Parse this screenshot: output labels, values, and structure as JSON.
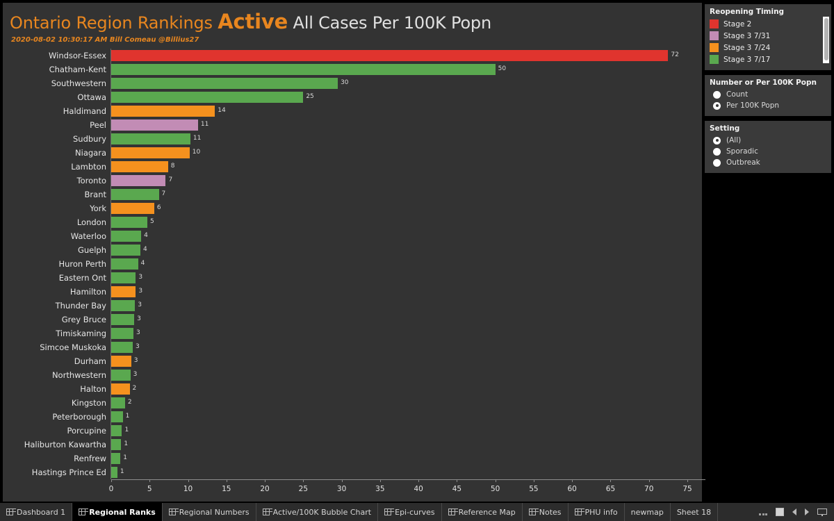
{
  "header": {
    "title_main": "Ontario Region Rankings ",
    "title_emphasis": "Active",
    "title_rest": " All Cases Per 100K Popn",
    "subtitle": "2020-08-02 10:30:17 AM Bill Comeau @Billius27"
  },
  "colors": {
    "stage2_red": "#e0342e",
    "stage3_0731_purple": "#c28cb5",
    "stage3_0724_orange": "#f5911e",
    "stage3_0717_green": "#5aa84f",
    "background": "#333333",
    "panel": "#3a3a3a",
    "accent_orange": "#e8861f"
  },
  "legend": {
    "title": "Reopening Timing",
    "items": [
      {
        "label": "Stage 2",
        "color": "#e0342e"
      },
      {
        "label": "Stage 3 7/31",
        "color": "#c28cb5"
      },
      {
        "label": "Stage 3 7/24",
        "color": "#f5911e"
      },
      {
        "label": "Stage 3 7/17",
        "color": "#5aa84f"
      }
    ]
  },
  "number_filter": {
    "title": "Number or Per 100K Popn",
    "options": [
      {
        "label": "Count",
        "selected": false
      },
      {
        "label": "Per 100K Popn",
        "selected": true
      }
    ]
  },
  "setting_filter": {
    "title": "Setting",
    "options": [
      {
        "label": "(All)",
        "selected": true
      },
      {
        "label": "Sporadic",
        "selected": false
      },
      {
        "label": "Outbreak",
        "selected": false
      }
    ]
  },
  "chart_data": {
    "type": "bar",
    "orientation": "horizontal",
    "title": "Ontario Region Rankings Active All Cases Per 100K Popn",
    "xlabel": "",
    "ylabel": "",
    "xlim": [
      0,
      77.3
    ],
    "xticks": [
      0,
      5,
      10,
      15,
      20,
      25,
      30,
      35,
      40,
      45,
      50,
      55,
      60,
      65,
      70,
      75
    ],
    "grid": false,
    "legend_position": "right",
    "color_key": {
      "Stage 2": "#e0342e",
      "Stage 3 7/31": "#c28cb5",
      "Stage 3 7/24": "#f5911e",
      "Stage 3 7/17": "#5aa84f"
    },
    "categories": [
      "Windsor-Essex",
      "Chatham-Kent",
      "Southwestern",
      "Ottawa",
      "Haldimand",
      "Peel",
      "Sudbury",
      "Niagara",
      "Lambton",
      "Toronto",
      "Brant",
      "York",
      "London",
      "Waterloo",
      "Guelph",
      "Huron Perth",
      "Eastern Ont",
      "Hamilton",
      "Thunder Bay",
      "Grey Bruce",
      "Timiskaming",
      "Simcoe Muskoka",
      "Durham",
      "Northwestern",
      "Halton",
      "Kingston",
      "Peterborough",
      "Porcupine",
      "Haliburton Kawartha",
      "Renfrew",
      "Hastings Prince Ed"
    ],
    "values": [
      72,
      50,
      30,
      25,
      14,
      11,
      11,
      10,
      8,
      7,
      7,
      6,
      5,
      4,
      4,
      4,
      3,
      3,
      3,
      3,
      3,
      3,
      3,
      3,
      2,
      2,
      1,
      1,
      1,
      1,
      1
    ],
    "bar_lengths": [
      72.5,
      50.0,
      29.5,
      25.0,
      13.5,
      11.3,
      10.3,
      10.2,
      7.4,
      7.1,
      6.2,
      5.6,
      4.7,
      3.9,
      3.8,
      3.5,
      3.2,
      3.2,
      3.1,
      3.0,
      2.9,
      2.8,
      2.6,
      2.5,
      2.4,
      1.8,
      1.5,
      1.4,
      1.3,
      1.2,
      0.8
    ],
    "bar_colors": [
      "#e0342e",
      "#5aa84f",
      "#5aa84f",
      "#5aa84f",
      "#f5911e",
      "#c28cb5",
      "#5aa84f",
      "#f5911e",
      "#f5911e",
      "#c28cb5",
      "#5aa84f",
      "#f5911e",
      "#5aa84f",
      "#5aa84f",
      "#5aa84f",
      "#5aa84f",
      "#5aa84f",
      "#f5911e",
      "#5aa84f",
      "#5aa84f",
      "#5aa84f",
      "#5aa84f",
      "#f5911e",
      "#5aa84f",
      "#f5911e",
      "#5aa84f",
      "#5aa84f",
      "#5aa84f",
      "#5aa84f",
      "#5aa84f",
      "#5aa84f"
    ]
  },
  "tabs": [
    {
      "label": "Dashboard 1",
      "active": false,
      "icon": true
    },
    {
      "label": "Regional Ranks",
      "active": true,
      "icon": true
    },
    {
      "label": "Regional Numbers",
      "active": false,
      "icon": true
    },
    {
      "label": "Active/100K Bubble Chart",
      "active": false,
      "icon": true
    },
    {
      "label": "Epi-curves",
      "active": false,
      "icon": true
    },
    {
      "label": "Reference Map",
      "active": false,
      "icon": true
    },
    {
      "label": "Notes",
      "active": false,
      "icon": true
    },
    {
      "label": "PHU info",
      "active": false,
      "icon": true
    },
    {
      "label": "newmap",
      "active": false,
      "icon": false
    },
    {
      "label": "Sheet 18",
      "active": false,
      "icon": false
    }
  ]
}
